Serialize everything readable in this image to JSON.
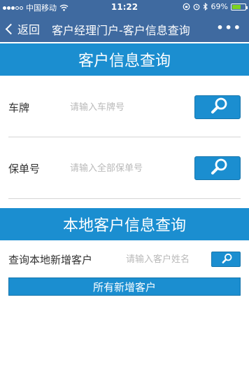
{
  "status_bar": {
    "carrier": "中国移动",
    "time": "11:22",
    "battery_percent": "69%",
    "battery_level": 0.69
  },
  "nav": {
    "back_label": "返回",
    "title": "客户经理门户-客户信息查询",
    "more_label": "•••"
  },
  "customer_query": {
    "header": "客户信息查询",
    "plate": {
      "label": "车牌",
      "placeholder": "请输入车牌号"
    },
    "policy": {
      "label": "保单号",
      "placeholder": "请输入全部保单号"
    }
  },
  "local_query": {
    "header": "本地客户信息查询",
    "new_customer": {
      "label": "查询本地新增客户",
      "placeholder": "请输入客户姓名"
    },
    "all_button_label": "所有新增客户"
  },
  "colors": {
    "nav_bg": "#3f6aa0",
    "accent": "#1b8ed0",
    "divider": "#d5d5d5",
    "placeholder": "#b9b9b9"
  }
}
